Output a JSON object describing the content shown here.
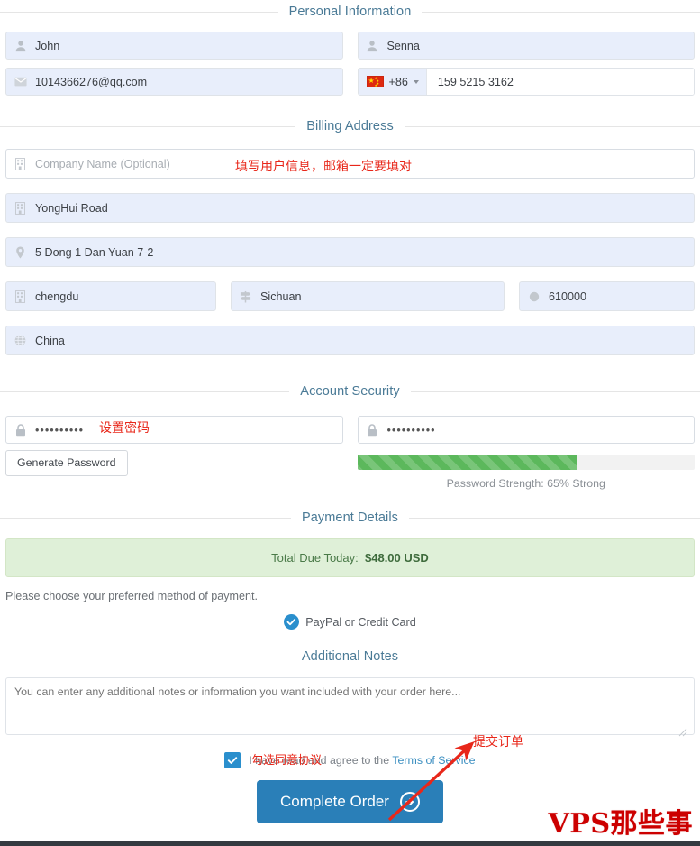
{
  "sections": {
    "personal": "Personal Information",
    "billing": "Billing Address",
    "security": "Account Security",
    "payment": "Payment Details",
    "notes": "Additional Notes"
  },
  "personal": {
    "first_name": {
      "value": "John",
      "icon": "user-icon"
    },
    "last_name": {
      "value": "Senna",
      "icon": "user-icon"
    },
    "email": {
      "value": "1014366276@qq.com",
      "icon": "envelope-icon"
    },
    "phone": {
      "country_code": "+86",
      "flag": "china-flag-icon",
      "number": "159 5215 3162"
    }
  },
  "billing": {
    "company": {
      "placeholder": "Company Name (Optional)",
      "value": "",
      "icon": "building-icon"
    },
    "address1": {
      "value": "YongHui Road",
      "icon": "building-icon"
    },
    "address2": {
      "value": "5 Dong 1 Dan Yuan 7-2",
      "icon": "map-marker-icon"
    },
    "city": {
      "value": "chengdu",
      "icon": "building-icon"
    },
    "state": {
      "value": "Sichuan",
      "icon": "map-signs-icon"
    },
    "postcode": {
      "value": "610000",
      "icon": "circle-icon"
    },
    "country": {
      "value": "China",
      "icon": "globe-icon"
    }
  },
  "security": {
    "password": {
      "value": "••••••••••",
      "icon": "lock-icon"
    },
    "confirm_password": {
      "value": "••••••••••",
      "icon": "lock-icon"
    },
    "generate_button": "Generate Password",
    "strength_percent": 65,
    "strength_label": "Password Strength: 65% Strong",
    "strength_color": "#5cb85c"
  },
  "payment": {
    "total_label": "Total Due Today:",
    "total_amount": "$48.00 USD",
    "lead": "Please choose your preferred method of payment.",
    "method_selected": "PayPal or Credit Card",
    "banner_bg": "#dff0d8",
    "accent": "#2a8fcd"
  },
  "notes": {
    "placeholder": "You can enter any additional notes or information you want included with your order here..."
  },
  "footer": {
    "tos_prefix": "I have read and agree to the ",
    "tos_link": "Terms of Service",
    "submit_label": "Complete Order",
    "submit_color": "#2a7fb8",
    "checkbox_checked": true
  },
  "annotations": {
    "fill_user_info": "填写用户信息，邮箱一定要填对",
    "set_password": "设置密码",
    "submit_order": "提交订单",
    "agree_terms": "勾选同意协议",
    "watermark": "VPS那些事",
    "color": "#e8271a"
  }
}
